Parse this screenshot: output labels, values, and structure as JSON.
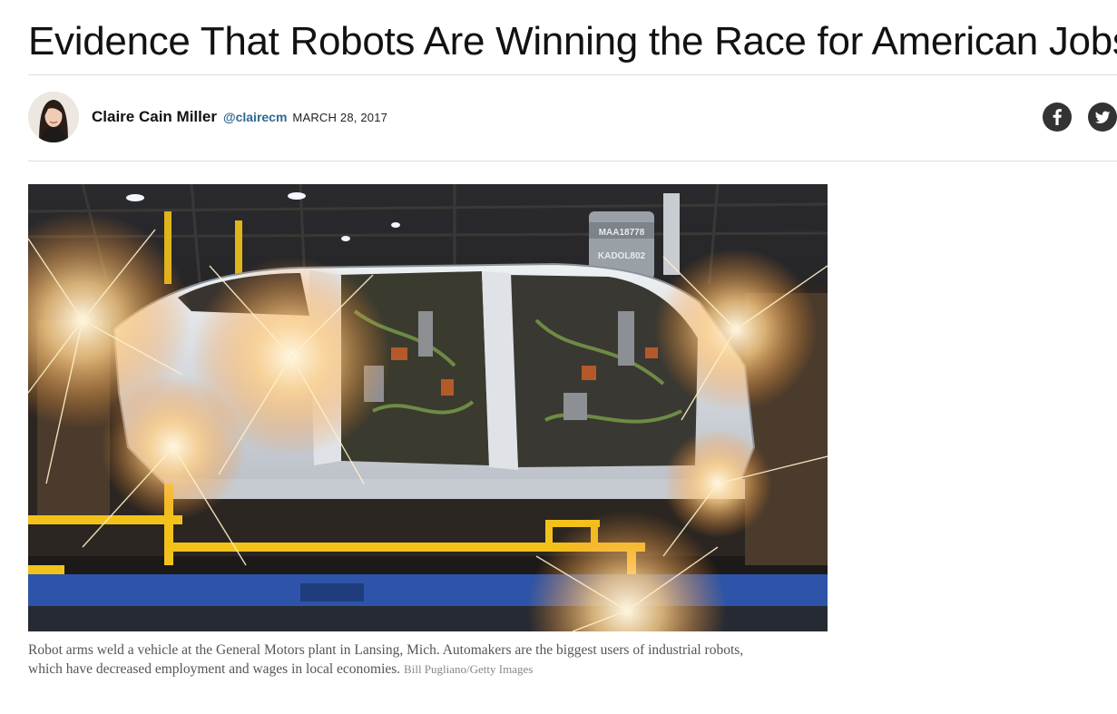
{
  "article": {
    "headline": "Evidence That Robots Are Winning the Race for American Jobs",
    "byline": {
      "author": "Claire Cain Miller",
      "handle": "@clairecm",
      "date": "MARCH 28, 2017"
    },
    "share": [
      {
        "network": "facebook",
        "icon": "facebook-icon"
      },
      {
        "network": "twitter",
        "icon": "twitter-icon"
      }
    ],
    "image": {
      "caption": "Robot arms weld a vehicle at the General Motors plant in Lansing, Mich. Automakers are the biggest users of industrial robots, which have decreased employment and wages in local economies.",
      "credit": "Bill Pugliano/Getty Images",
      "sign_text_1": "MAA18778",
      "sign_text_2": "KADOL802"
    },
    "colors": {
      "link": "#326891",
      "icon_bg": "#333333",
      "rule": "#dedede",
      "car_body": "#d9dde2",
      "rail_yellow": "#f2c21b",
      "rail_blue": "#2d54a8"
    }
  }
}
